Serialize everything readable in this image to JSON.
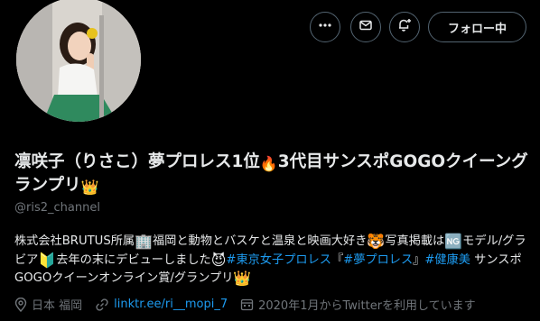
{
  "header": {
    "more_icon": "more-icon",
    "message_icon": "envelope-icon",
    "notify_icon": "bell-plus-icon",
    "follow_label": "フォロー中"
  },
  "profile": {
    "name_text": "凛咲子（りさこ）夢プロレス1位",
    "name_emoji1": "🔥",
    "name_text2": "3代目サンスポGOGOクイーングランプリ",
    "name_emoji2": "👑",
    "handle": "@ris2_channel"
  },
  "bio": {
    "p1": "株式会社BRUTUS所属",
    "e1": "🏢",
    "p2": "福岡と動物とバスケと温泉と映画大好き",
    "e2": "🐯",
    "p3": "写真掲載は",
    "e3": "🆖",
    "p4": "モデル/グラビア",
    "e4": "🔰",
    "p5": "去年の末にデビューしました",
    "e5": "😈",
    "tag1": "#東京女子プロレス",
    "p6": "『",
    "tag2": "#夢プロレス",
    "p7": "』",
    "tag3": "#健康美",
    "p8": " サンスポGOGOクイーンオンライン賞/グランプリ",
    "e6": "👑"
  },
  "meta": {
    "location": "日本 福岡",
    "link": "linktr.ee/ri__mopi_7",
    "joined": "2020年1月からTwitterを利用しています"
  },
  "colors": {
    "background": "#000000",
    "text": "#e7e9ea",
    "muted": "#71767b",
    "link": "#1d9bf0"
  }
}
